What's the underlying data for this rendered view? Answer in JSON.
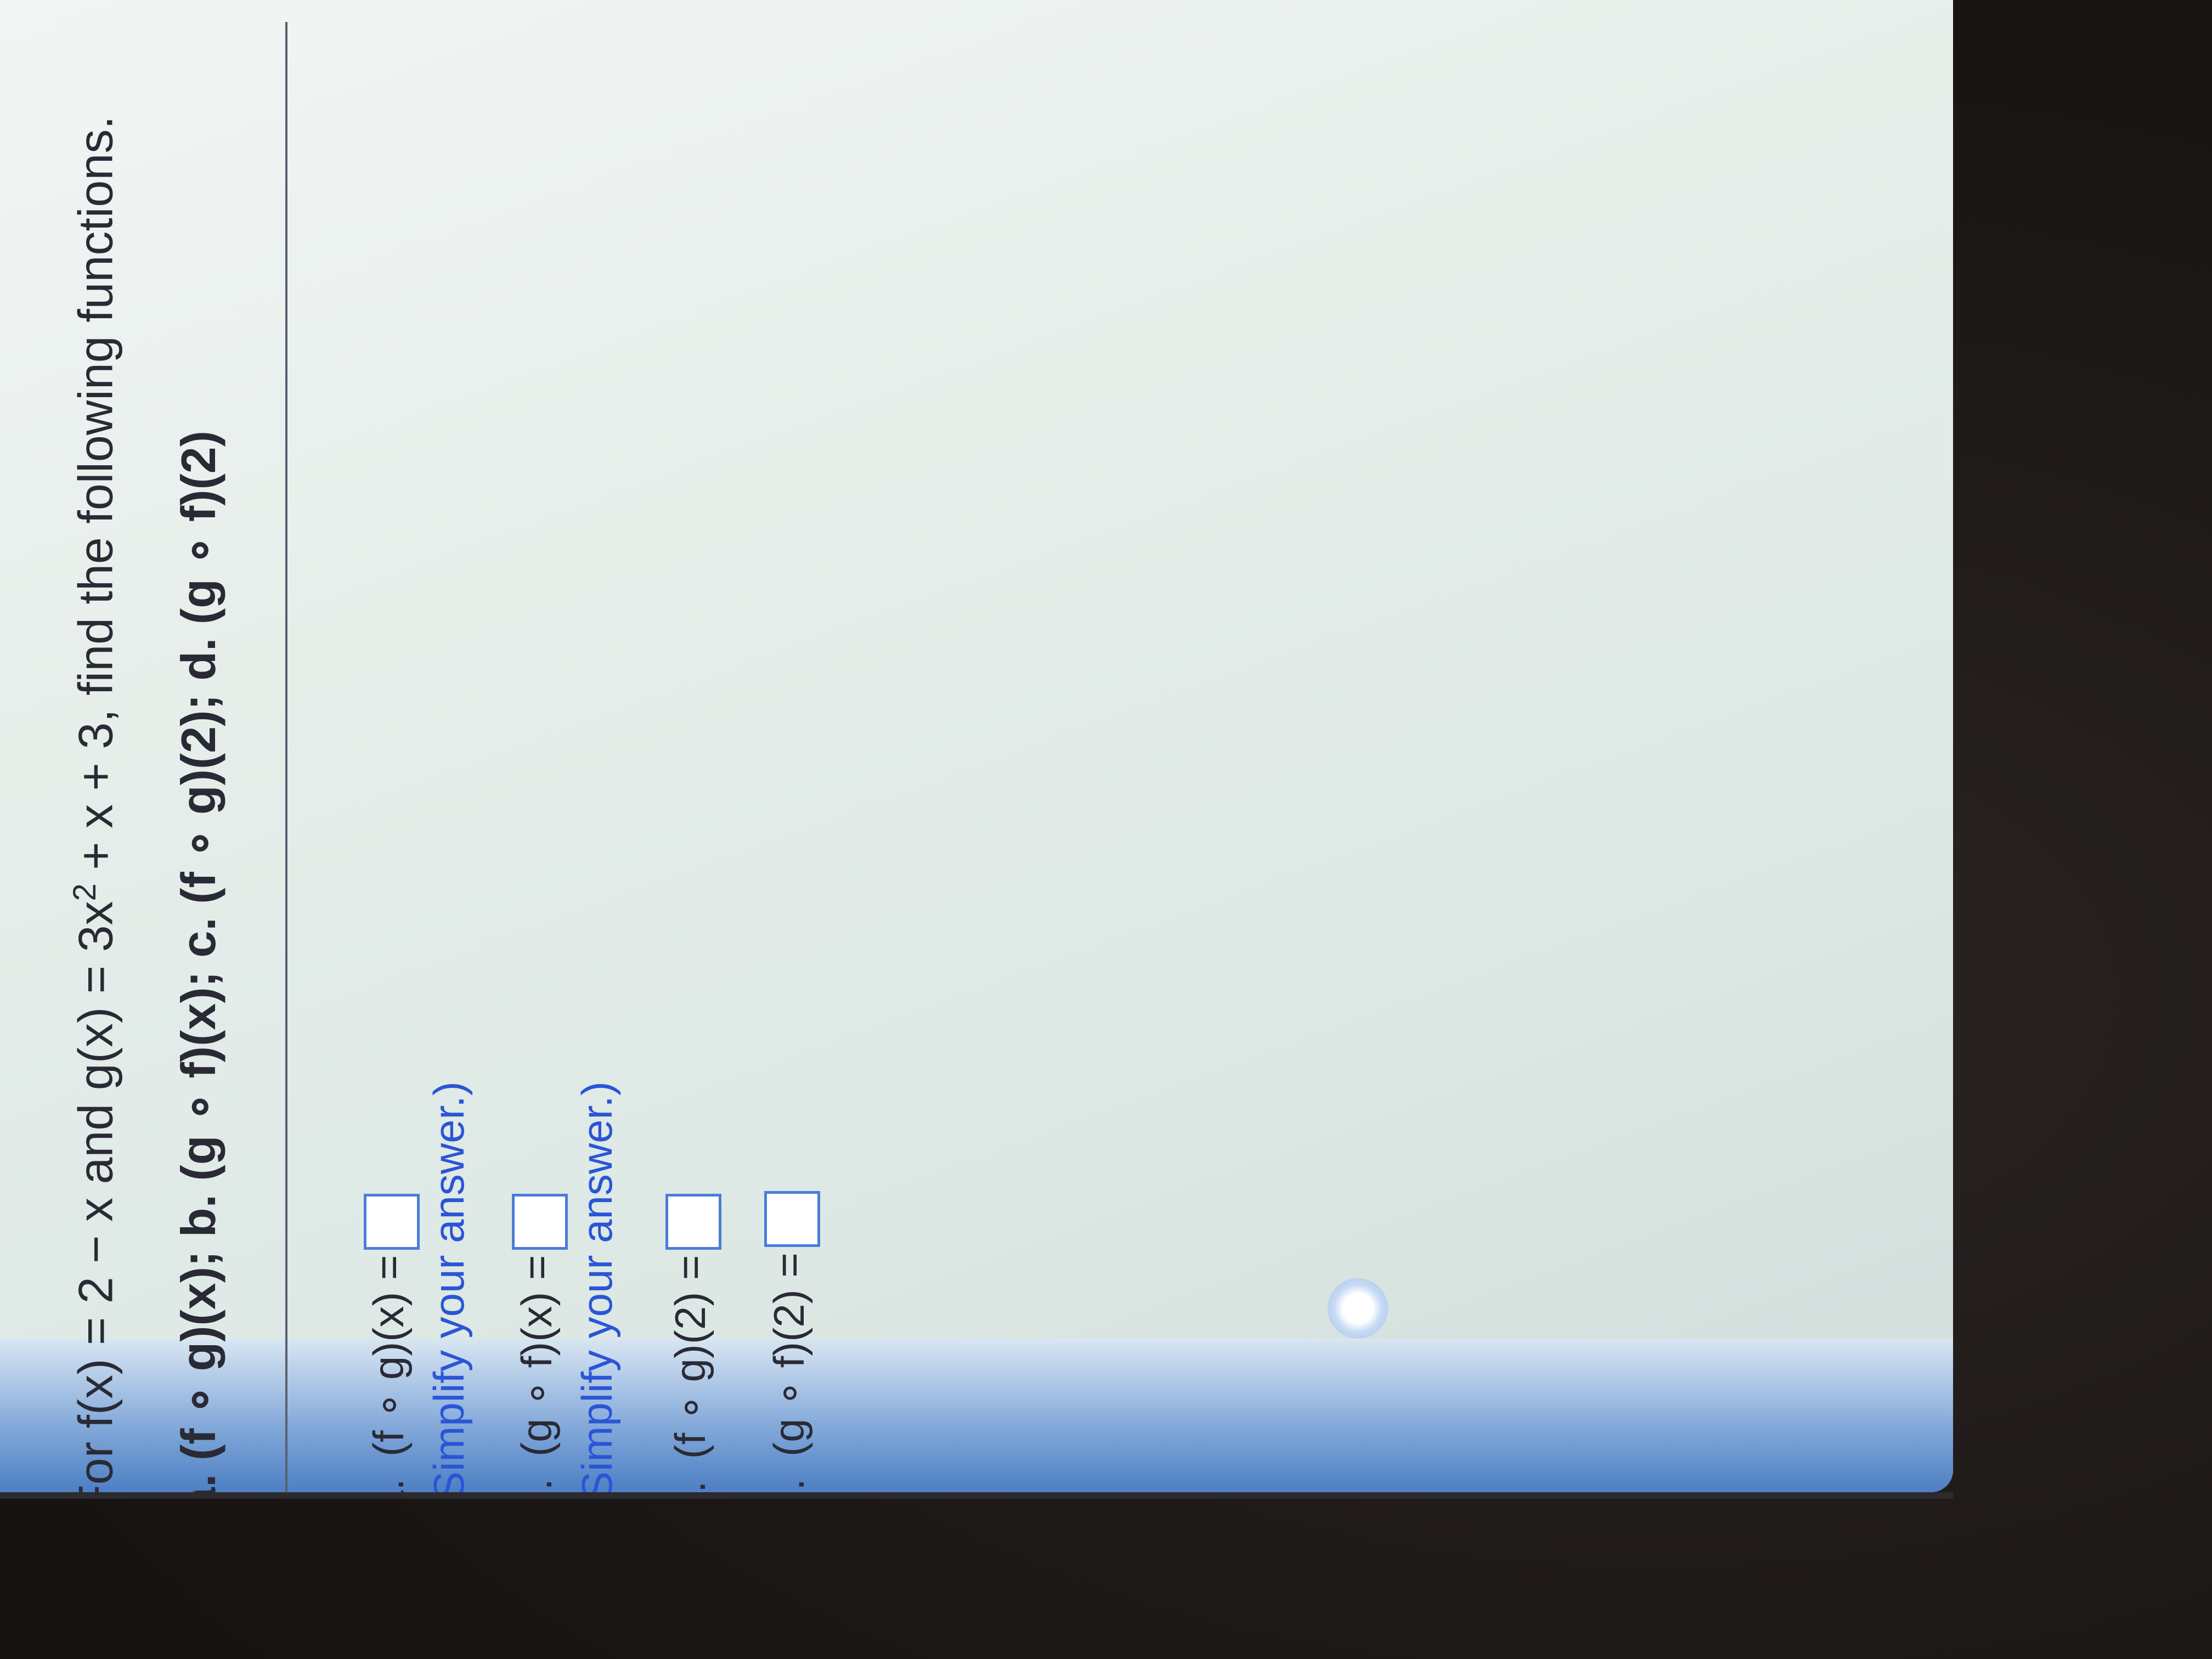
{
  "problem": {
    "prefix": "For f(x) = 2 − x and g(x) = 3x",
    "exponent": "2",
    "suffix": " + x + 3, find the following functions.",
    "parts_list": "a. (f ∘ g)(x); b. (g ∘ f)(x); c. (f ∘ g)(2); d. (g ∘ f)(2)"
  },
  "parts": [
    {
      "letter": "a.",
      "expression": "(f ∘ g)(x) =",
      "hint": "(Simplify your answer.)"
    },
    {
      "letter": "b.",
      "expression": "(g ∘ f)(x) =",
      "hint": "(Simplify your answer.)"
    },
    {
      "letter": "c.",
      "expression": "(f ∘ g)(2) =",
      "hint": ""
    },
    {
      "letter": "d.",
      "expression": "(g ∘ f)(2) =",
      "hint": ""
    }
  ],
  "colors": {
    "accent": "#2a55d6",
    "box_border": "#4b7dd8",
    "text": "#2a2a35"
  }
}
